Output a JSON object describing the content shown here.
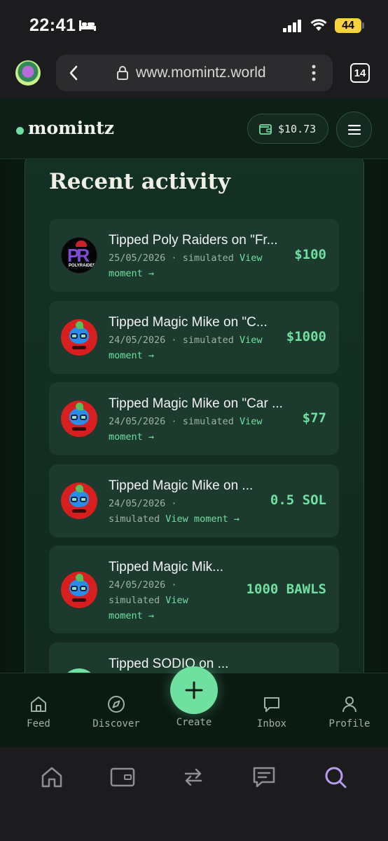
{
  "status_bar": {
    "time": "22:41",
    "battery": "44"
  },
  "browser": {
    "url": "www.momintz.world",
    "tab_count": "14"
  },
  "header": {
    "logo": "momintz",
    "wallet_balance": "$10.73"
  },
  "section": {
    "title": "Recent activity"
  },
  "activity": [
    {
      "title": "Tipped Poly Raiders on \"Fr...",
      "date": "25/05/2026",
      "sep": "·",
      "status": "simulated",
      "link_a": "View",
      "link_b": "moment →",
      "amount": "$100",
      "avatar": "poly-raiders-avatar"
    },
    {
      "title": "Tipped Magic Mike on \"C...",
      "date": "24/05/2026",
      "sep": "·",
      "status": "simulated",
      "link_a": "View",
      "link_b": "moment →",
      "amount": "$1000",
      "avatar": "magic-mike-avatar"
    },
    {
      "title": "Tipped Magic Mike on \"Car ...",
      "date": "24/05/2026",
      "sep": "·",
      "status": "simulated",
      "link_a": "View",
      "link_b": "moment →",
      "amount": "$77",
      "avatar": "magic-mike-avatar"
    },
    {
      "title": "Tipped Magic Mike on ...",
      "date": "24/05/2026",
      "sep": "·",
      "status": "simulated",
      "link_a": "View moment →",
      "amount": "0.5 SOL",
      "avatar": "magic-mike-avatar"
    },
    {
      "title": "Tipped Magic Mik...",
      "date": "24/05/2026",
      "sep": "·",
      "status": "simulated",
      "link_a": "View",
      "link_b": "moment →",
      "amount": "1000 BAWLS",
      "avatar": "magic-mike-avatar"
    },
    {
      "title": "Tipped SODIO on ...",
      "avatar": "sodio-avatar"
    }
  ],
  "bottom_nav": {
    "feed": "Feed",
    "discover": "Discover",
    "create": "Create",
    "inbox": "Inbox",
    "profile": "Profile"
  },
  "colors": {
    "accent": "#6fe0a0",
    "background": "#0d1f17",
    "card": "#1c3a2d"
  },
  "icons": [
    "bed-icon",
    "signal-icon",
    "wifi-icon",
    "back-icon",
    "lock-icon",
    "more-vertical-icon",
    "wallet-icon",
    "menu-icon",
    "home-icon",
    "compass-icon",
    "plus-icon",
    "chat-icon",
    "user-icon",
    "search-icon",
    "repeat-icon",
    "card-icon"
  ]
}
